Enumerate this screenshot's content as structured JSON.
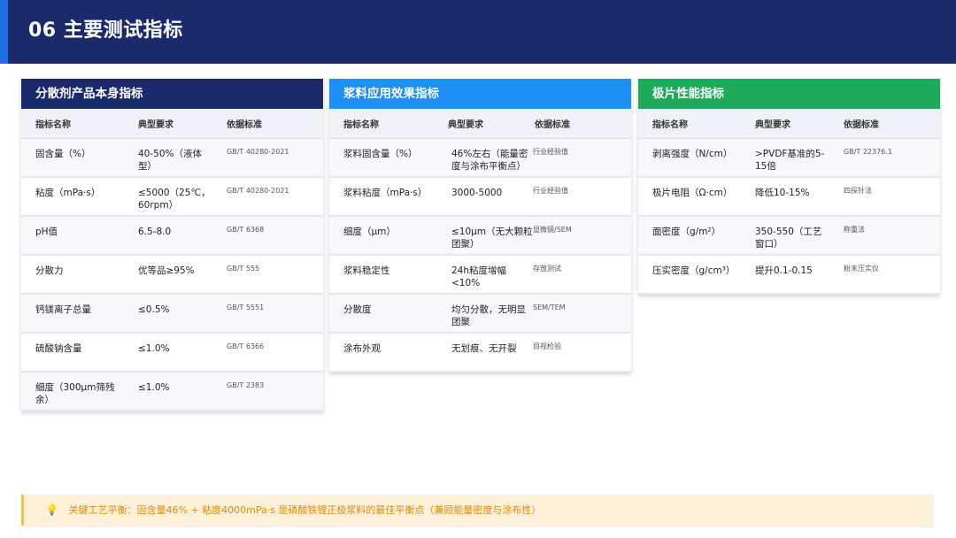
{
  "header": {
    "title": "06  主要测试指标"
  },
  "columns": {
    "name": "指标名称",
    "requirement": "典型要求",
    "standard": "依据标准"
  },
  "cards": [
    {
      "title": "分散剂产品本身指标",
      "rows": [
        {
          "name": "固含量（%）",
          "requirement": "40-50%（液体型）",
          "standard": "GB/T 40280-2021"
        },
        {
          "name": "粘度（mPa·s）",
          "requirement": "≤5000（25℃，60rpm）",
          "standard": "GB/T 40280-2021"
        },
        {
          "name": "pH值",
          "requirement": "6.5-8.0",
          "standard": "GB/T 6368"
        },
        {
          "name": "分散力",
          "requirement": "优等品≥95%",
          "standard": "GB/T 555"
        },
        {
          "name": "钙镁离子总量",
          "requirement": "≤0.5%",
          "standard": "GB/T 5551"
        },
        {
          "name": "硫酸钠含量",
          "requirement": "≤1.0%",
          "standard": "GB/T 6366"
        },
        {
          "name": "细度（300μm筛残余）",
          "requirement": "≤1.0%",
          "standard": "GB/T 2383"
        }
      ]
    },
    {
      "title": "浆料应用效果指标",
      "rows": [
        {
          "name": "浆料固含量（%）",
          "requirement": "46%左右（能量密度与涂布平衡点）",
          "standard": "行业经验值"
        },
        {
          "name": "浆料粘度（mPa·s）",
          "requirement": "3000-5000",
          "standard": "行业经验值"
        },
        {
          "name": "细度（μm）",
          "requirement": "≤10μm（无大颗粒团聚）",
          "standard": "显微镜/SEM"
        },
        {
          "name": "浆料稳定性",
          "requirement": "24h粘度增幅<10%",
          "standard": "存放测试"
        },
        {
          "name": "分散度",
          "requirement": "均匀分散，无明显团聚",
          "standard": "SEM/TEM"
        },
        {
          "name": "涂布外观",
          "requirement": "无划痕、无开裂",
          "standard": "目视检验"
        }
      ]
    },
    {
      "title": "极片性能指标",
      "rows": [
        {
          "name": "剥离强度（N/cm）",
          "requirement": ">PVDF基准的5-15倍",
          "standard": "GB/T 22376.1"
        },
        {
          "name": "极片电阻（Ω·cm）",
          "requirement": "降低10-15%",
          "standard": "四探针法"
        },
        {
          "name": "面密度（g/m²）",
          "requirement": "350-550（工艺窗口）",
          "standard": "称重法"
        },
        {
          "name": "压实密度（g/cm³）",
          "requirement": "提升0.1-0.15",
          "standard": "粉末压实仪"
        }
      ]
    }
  ],
  "note": {
    "icon": "lightbulb-icon",
    "text": "关键工艺平衡：固含量46% + 粘度4000mPa·s 是磷酸铁锂正极浆料的最佳平衡点（兼顾能量密度与涂布性）"
  }
}
